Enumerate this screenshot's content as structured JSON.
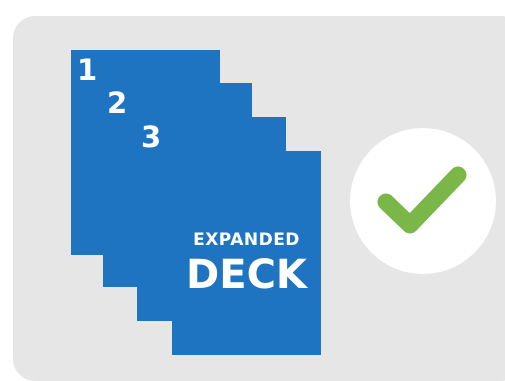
{
  "sheets": [
    {
      "number": "1"
    },
    {
      "number": "2"
    },
    {
      "number": "3"
    }
  ],
  "cover": {
    "line1": "EXPANDED",
    "line2": "DECK"
  },
  "status": {
    "icon": "checkmark-icon",
    "check_color": "#7ab648"
  },
  "colors": {
    "deck_blue": "#1e74c0",
    "panel_gray": "#e6e6e6"
  }
}
